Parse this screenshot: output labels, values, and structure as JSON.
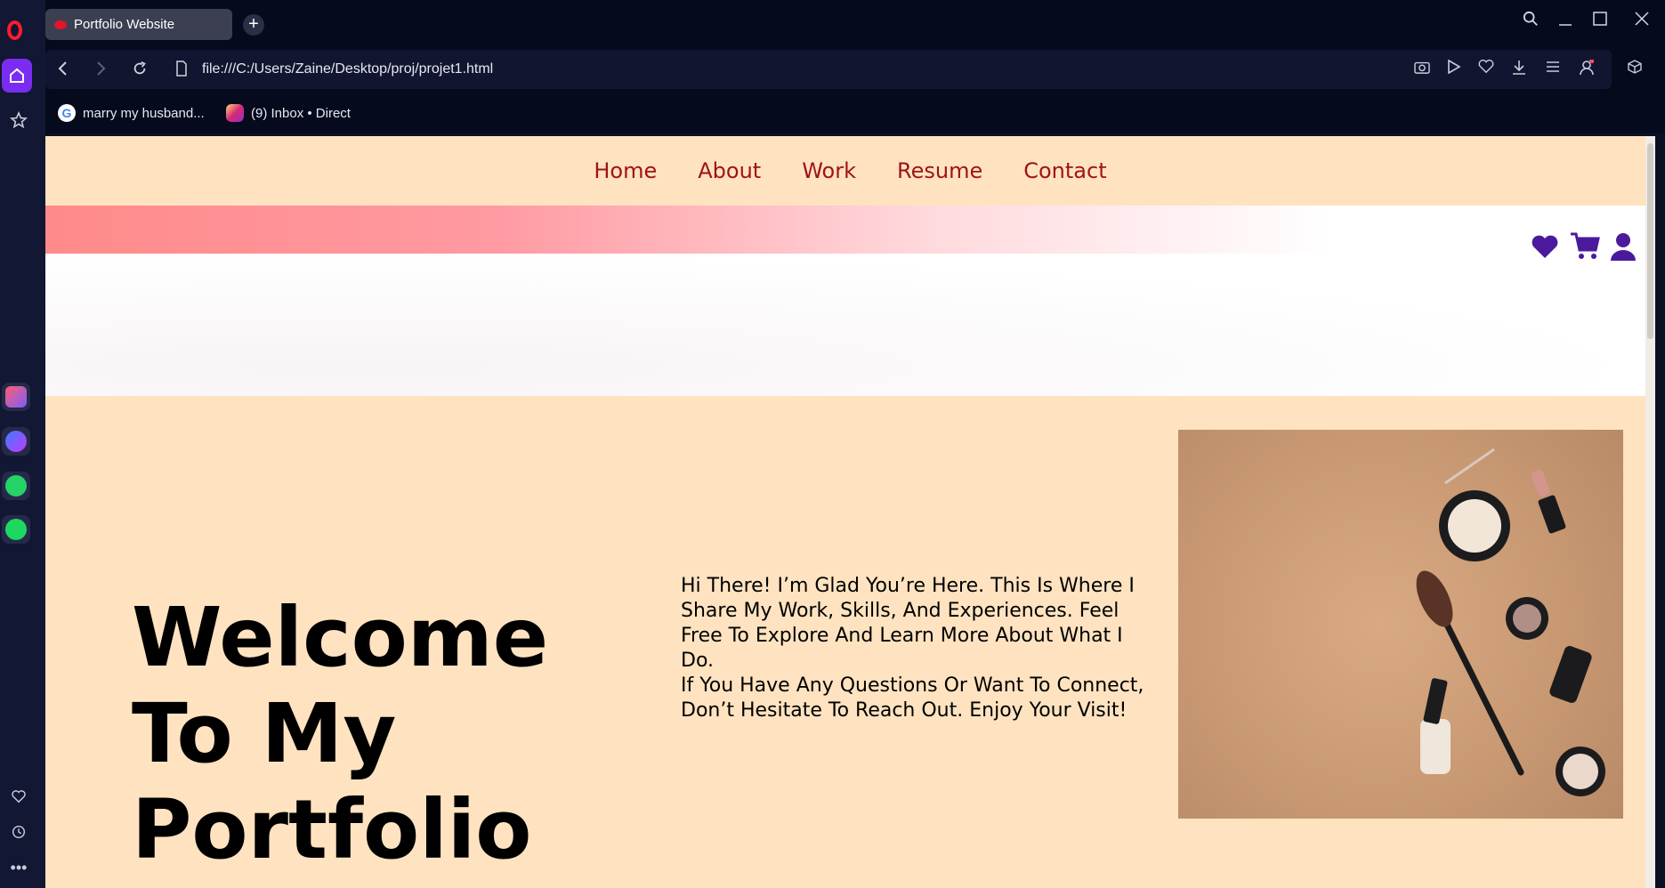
{
  "browser": {
    "tab_title": "Portfolio Website",
    "new_tab": "+",
    "url": "file:///C:/Users/Zaine/Desktop/proj/projet1.html",
    "bookmarks": [
      {
        "label": "marry my husband..."
      },
      {
        "label": "(9) Inbox • Direct"
      }
    ]
  },
  "nav": {
    "items": [
      "Home",
      "About",
      "Work",
      "Resume",
      "Contact"
    ],
    "color": "#a0121b"
  },
  "hero": {
    "title_lines": [
      "Welcome",
      "To My",
      "Portfolio"
    ],
    "intro_p1": "Hi There! I’m Glad You’re Here. This Is Where I Share My Work, Skills, And Experiences. Feel Free To Explore And Learn More About What I Do.",
    "intro_p2": "If You Have Any Questions Or Want To Connect, Don’t Hesitate To Reach Out. Enjoy Your Visit!"
  },
  "colors": {
    "page_bg": "#ffe3c0",
    "icon_purple": "#4b1a9c",
    "opera_red": "#ff1b2d",
    "sidebar_accent": "#7a2cf2"
  },
  "icons": [
    "heart-icon",
    "cart-icon",
    "user-icon"
  ]
}
